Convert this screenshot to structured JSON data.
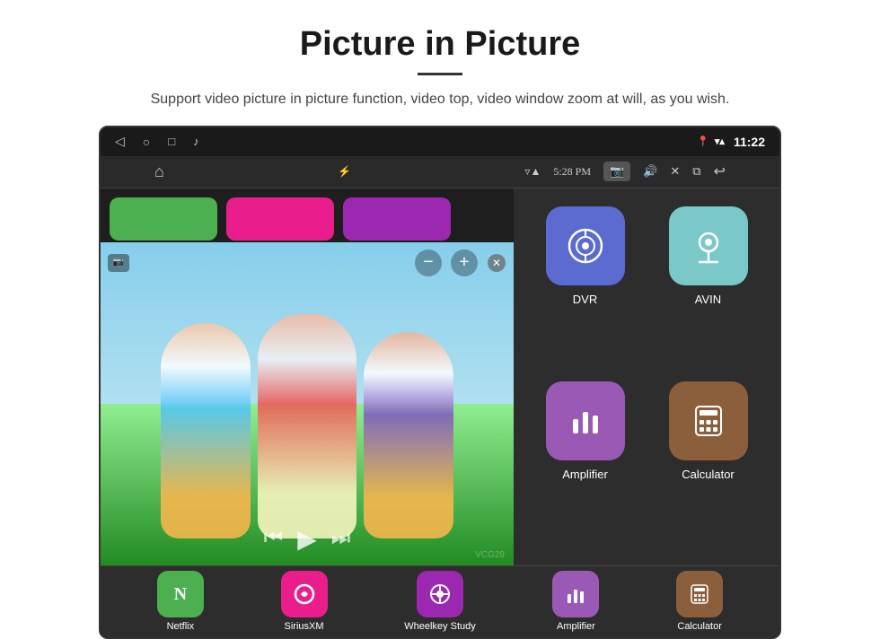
{
  "header": {
    "title": "Picture in Picture",
    "subtitle": "Support video picture in picture function, video top, video window zoom at will, as you wish."
  },
  "statusBar": {
    "time": "11:22",
    "pipTime": "5:28 PM"
  },
  "apps": {
    "grid": [
      {
        "id": "dvr",
        "label": "DVR",
        "colorClass": "dvr"
      },
      {
        "id": "avin",
        "label": "AVIN",
        "colorClass": "avin"
      },
      {
        "id": "amplifier",
        "label": "Amplifier",
        "colorClass": "amplifier"
      },
      {
        "id": "calculator",
        "label": "Calculator",
        "colorClass": "calculator"
      }
    ],
    "bottom": [
      {
        "id": "netflix",
        "label": "Netflix",
        "colorClass": "netflix"
      },
      {
        "id": "siriusxm",
        "label": "SiriusXM",
        "colorClass": "siriusxm"
      },
      {
        "id": "wheelkey",
        "label": "Wheelkey Study",
        "colorClass": "wheelkey"
      }
    ]
  },
  "watermark": "VCG29",
  "pip": {
    "minus": "−",
    "plus": "+",
    "close": "✕"
  }
}
